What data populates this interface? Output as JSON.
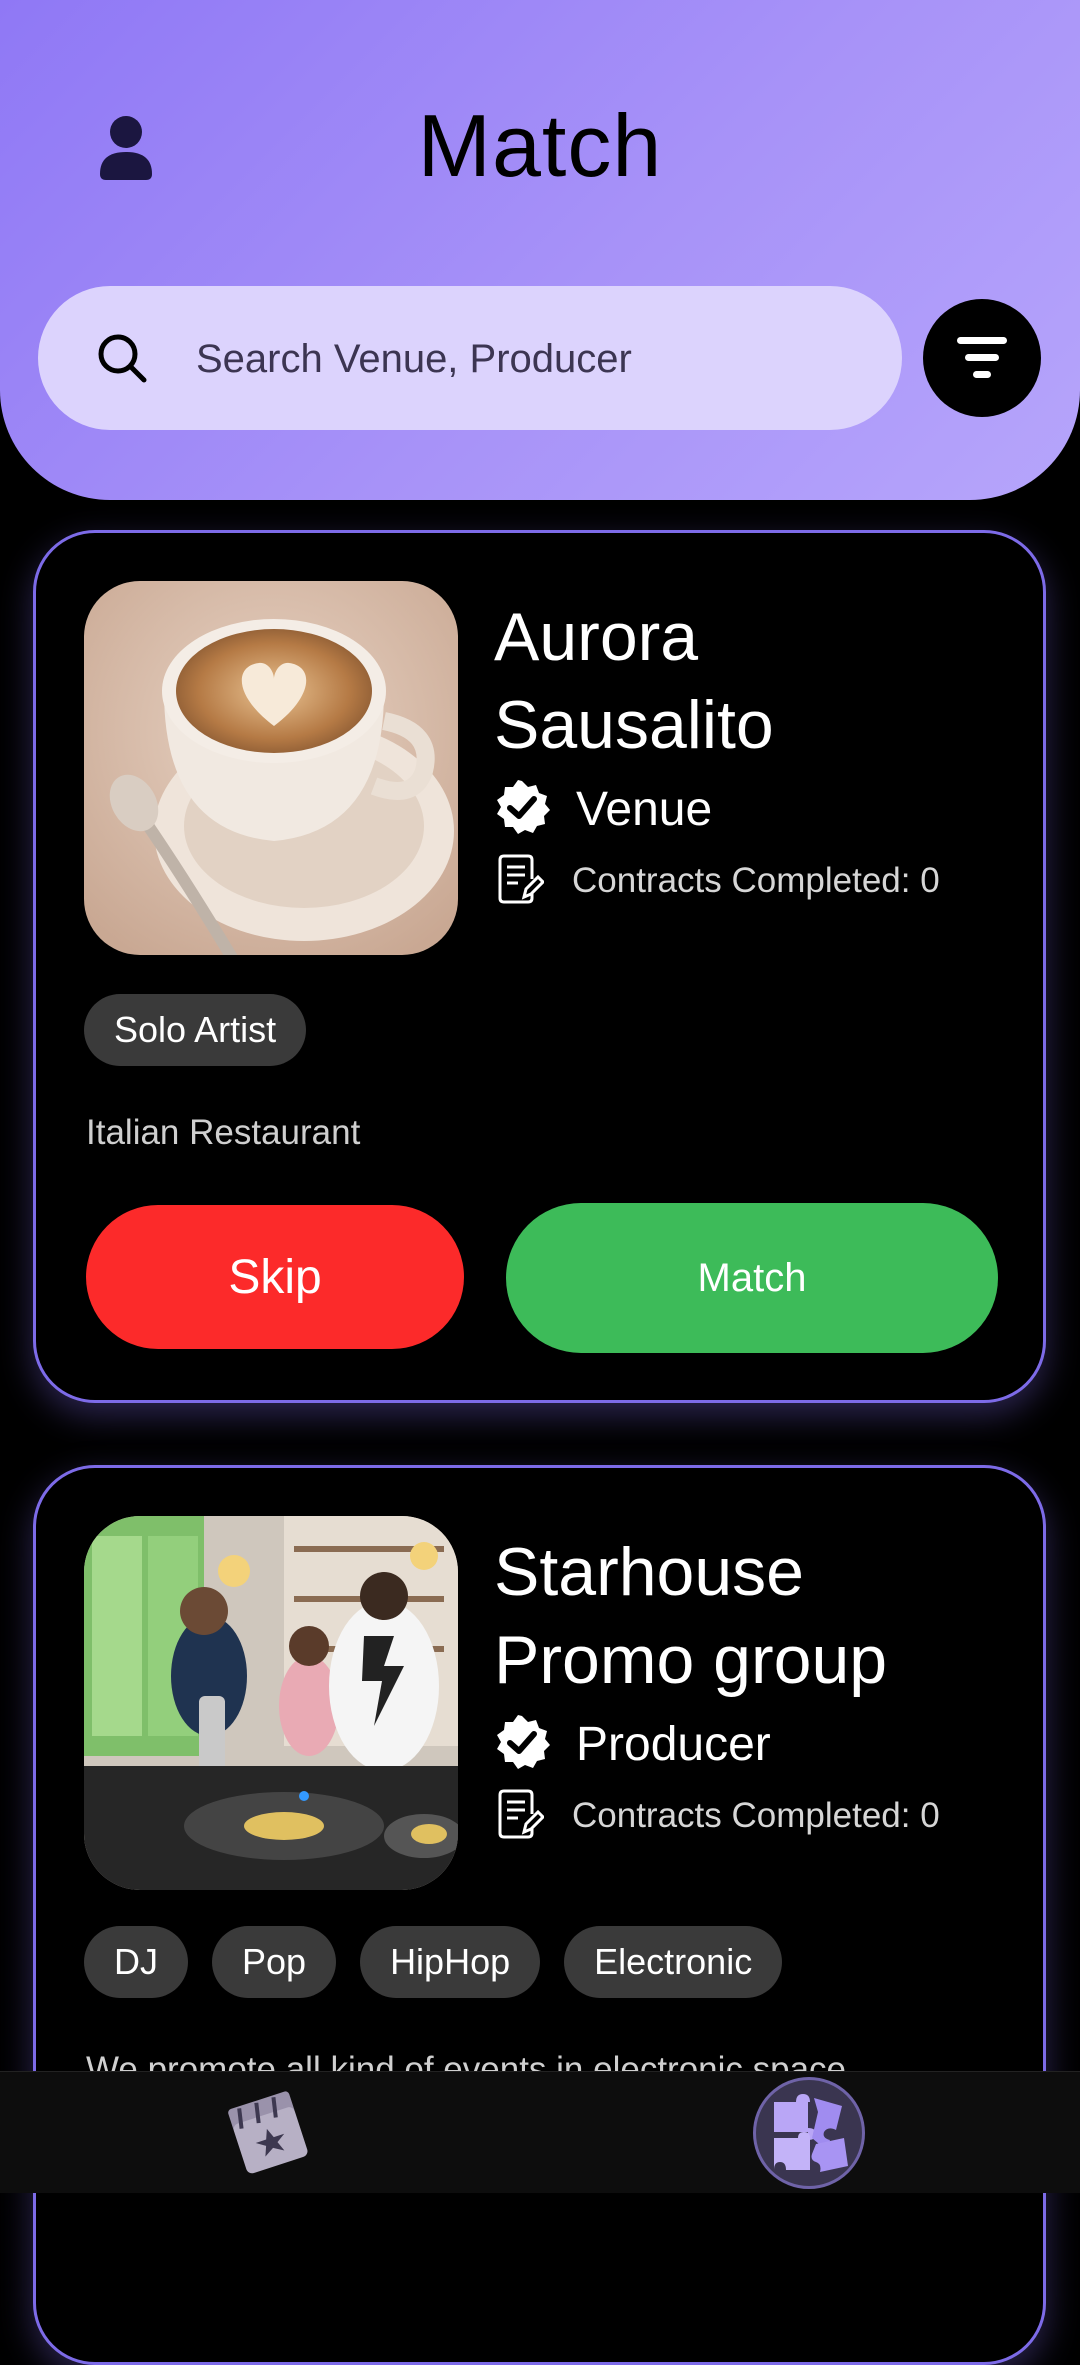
{
  "header": {
    "title": "Match",
    "search_placeholder": "Search Venue, Producer"
  },
  "cards": [
    {
      "name": "Aurora\nSausalito",
      "type": "Venue",
      "contracts": "Contracts Completed: 0",
      "tags": [
        "Solo Artist"
      ],
      "description": "Italian Restaurant",
      "skip_label": "Skip",
      "match_label": "Match"
    },
    {
      "name": "Starhouse\nPromo group",
      "type": "Producer",
      "contracts": "Contracts Completed: 0",
      "tags": [
        "DJ",
        "Pop",
        "HipHop",
        "Electronic"
      ],
      "description": "We promote all kind of events in electronic space"
    }
  ],
  "nav": {
    "items": [
      "events-icon",
      "puzzle-match-icon"
    ],
    "active": "puzzle-match-icon"
  },
  "colors": {
    "header_gradient_start": "#8f78f5",
    "header_gradient_end": "#b6a5fb",
    "search_bg": "#dcd3fd",
    "card_border": "#7d6be8",
    "skip": "#fc2a2a",
    "match": "#3dbb59",
    "tag_bg": "#3a3a3a"
  }
}
